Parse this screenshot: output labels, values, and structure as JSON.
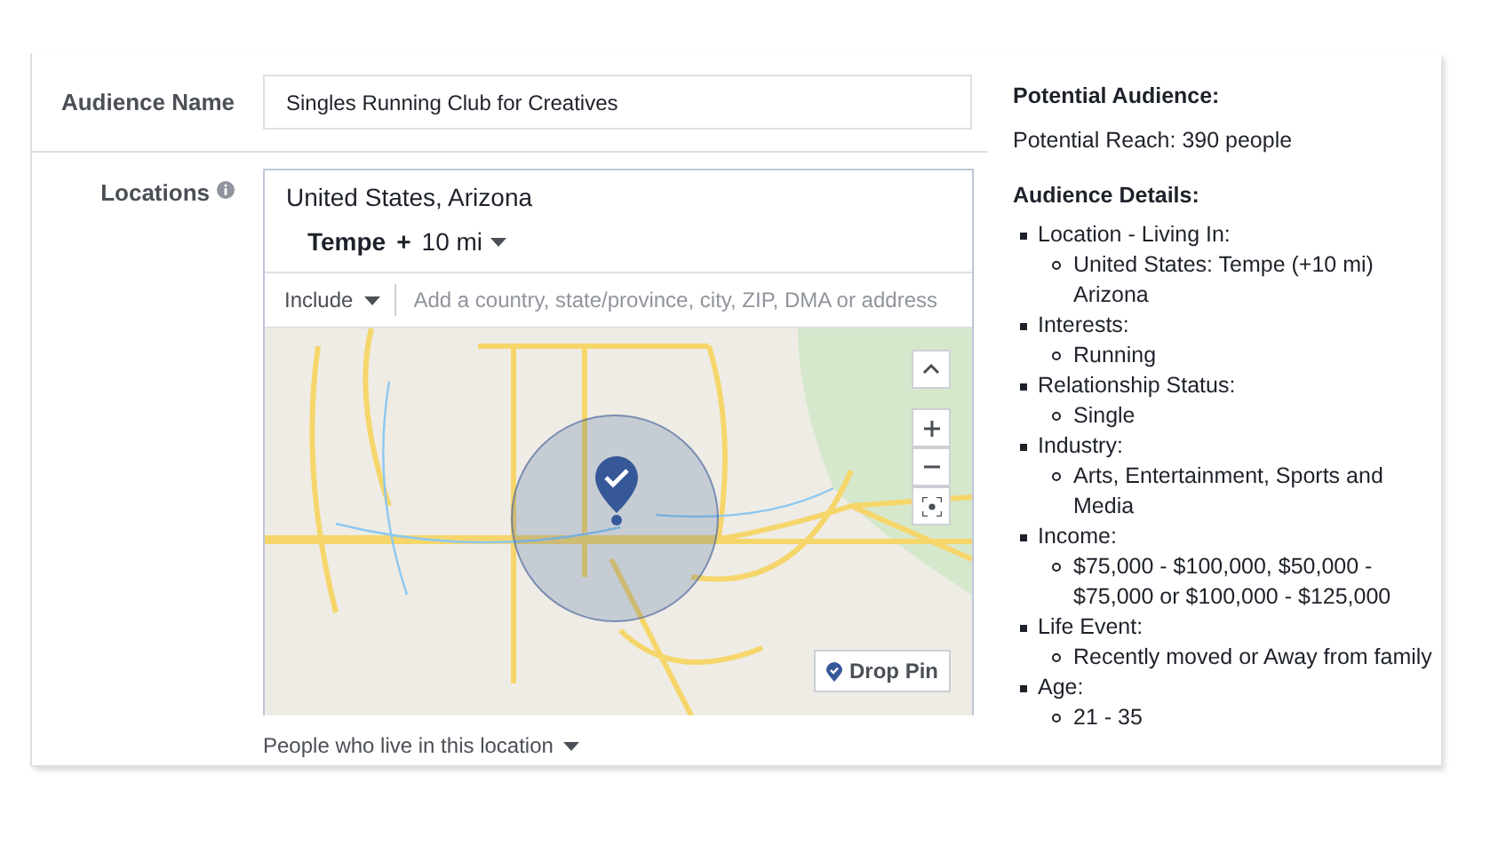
{
  "audience_name": {
    "label": "Audience Name",
    "value": "Singles Running Club for Creatives"
  },
  "locations": {
    "label": "Locations",
    "selected_region": "United States, Arizona",
    "city": "Tempe",
    "plus": "+",
    "radius": "10 mi",
    "include_dropdown": "Include",
    "placeholder": "Add a country, state/province, city, ZIP, DMA or address",
    "drop_pin": "Drop Pin",
    "people_filter": "People who live in this location"
  },
  "potential_audience": {
    "title": "Potential Audience:",
    "reach": "Potential Reach: 390 people"
  },
  "audience_details": {
    "title": "Audience Details:",
    "items": [
      {
        "label": "Location - Living In:",
        "children": [
          {
            "label": "United States: Tempe (+10 mi) Arizona"
          }
        ]
      },
      {
        "label": "Interests:",
        "children": [
          {
            "label": "Running"
          }
        ]
      },
      {
        "label": "Relationship Status:",
        "children": [
          {
            "label": "Single"
          }
        ]
      },
      {
        "label": "Industry:",
        "children": [
          {
            "label": "Arts, Entertainment, Sports and Media"
          }
        ]
      },
      {
        "label": "Income:",
        "children": [
          {
            "label": "$75,000 - $100,000, $50,000 - $75,000 or $100,000 - $125,000"
          }
        ]
      },
      {
        "label": "Life Event:",
        "children": [
          {
            "label": "Recently moved or Away from family"
          }
        ]
      },
      {
        "label": "Age:",
        "children": [
          {
            "label": "21 - 35"
          }
        ]
      }
    ]
  }
}
